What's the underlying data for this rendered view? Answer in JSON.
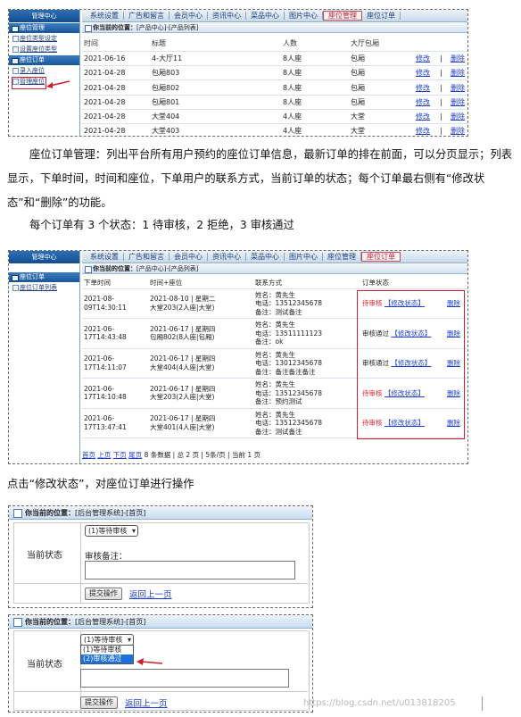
{
  "shot1": {
    "sidebar": {
      "header": "管理中心",
      "group1": "座位管理",
      "items1": [
        "座位类型设定",
        "设置座位类型"
      ],
      "group2": "座位订单",
      "items2": [
        "录入座位",
        "管理座位"
      ]
    },
    "nav": [
      "系统设置",
      "广告和留言",
      "会员中心",
      "资讯中心",
      "菜品中心",
      "图片中心",
      "座位管理",
      "座位订单"
    ],
    "crumb_label": "你当前的位置：",
    "crumb_path": "[产品中心]-[产品列表]",
    "columns": [
      "时间",
      "标题",
      "人数",
      "大厅包厢"
    ],
    "rows": [
      {
        "date": "2021-06-16",
        "title": "4-大厅11",
        "people": "8人座",
        "type": "包厢"
      },
      {
        "date": "2021-04-28",
        "title": "包厢803",
        "people": "8人座",
        "type": "包厢"
      },
      {
        "date": "2021-04-28",
        "title": "包厢802",
        "people": "8人座",
        "type": "包厢"
      },
      {
        "date": "2021-04-28",
        "title": "包厢801",
        "people": "8人座",
        "type": "包厢"
      },
      {
        "date": "2021-04-28",
        "title": "大堂404",
        "people": "4人座",
        "type": "大堂"
      },
      {
        "date": "2021-04-28",
        "title": "大堂403",
        "people": "4人座",
        "type": "大堂"
      }
    ],
    "edit": "修改",
    "del": "删除",
    "sep": "|"
  },
  "para1": "座位订单管理：列出平台所有用户预约的座位订单信息，最新订单的排在前面，可以分页显示；列表显示，下单时间，时间和座位，下单用户的联系方式，当前订单的状态；每个订单最右侧有“修改状态”和“删除”的功能。",
  "para2": "每个订单有 3 个状态：1 待审核，2 拒绝，3 审核通过",
  "shot2": {
    "sidebar": {
      "header": "管理中心",
      "group": "座位订单",
      "item": "座位订单列表"
    },
    "nav": [
      "系统设置",
      "广告和留言",
      "会员中心",
      "资讯中心",
      "菜品中心",
      "图片中心",
      "座位管理",
      "座位订单"
    ],
    "crumb_label": "你当前的位置：",
    "crumb_path": "[产品中心]-[产品列表]",
    "columns": [
      "下单时间",
      "时间+座位",
      "联系方式",
      "订单状态"
    ],
    "rows": [
      {
        "t1": "2021-08-",
        "t2": "09T14:30:11",
        "s1": "2021-08-10 | 星期二",
        "s2": "大堂203(2人座|大堂)",
        "c1": "姓名：黄先生",
        "c2": "电话：13512345678",
        "c3": "备注：测试备注",
        "status": "待审核",
        "red": true
      },
      {
        "t1": "2021-06-",
        "t2": "17T14:43:48",
        "s1": "2021-06-17 | 星期四",
        "s2": "包厢802(8人座|包厢)",
        "c1": "姓名：黄先生",
        "c2": "电话：13511111123",
        "c3": "备注：ok",
        "status": "审核通过",
        "red": false
      },
      {
        "t1": "2021-06-",
        "t2": "17T14:11:07",
        "s1": "2021-06-17 | 星期四",
        "s2": "大堂404(4人座|大堂)",
        "c1": "姓名：黄先生",
        "c2": "电话：13012345678",
        "c3": "备注：备注备注备注",
        "status": "审核通过",
        "red": false
      },
      {
        "t1": "2021-06-",
        "t2": "17T14:10:48",
        "s1": "2021-06-17 | 星期四",
        "s2": "大堂203(2人座|大堂)",
        "c1": "姓名：黄先生",
        "c2": "电话：13512345678",
        "c3": "备注：预约测试",
        "status": "待审核",
        "red": true
      },
      {
        "t1": "2021-06-",
        "t2": "17T13:47:41",
        "s1": "2021-06-17 | 星期四",
        "s2": "大堂401(4人座|大堂)",
        "c1": "姓名：黄先生",
        "c2": "电话：13512345678",
        "c3": "备注：测试备注",
        "status": "待审核",
        "red": true
      }
    ],
    "modify": "【修改状态】",
    "del": "删除",
    "pager": {
      "first": "首页",
      "prev": "上页",
      "next": "下页",
      "last": "尾页",
      "info": "8 条数据 | 总 2 页 | 5条/页 | 当前 1 页"
    }
  },
  "para3": "点击“修改状态”，对座位订单进行操作",
  "form1": {
    "crumb_label": "你当前的位置：",
    "crumb_path": "[后台管理系统]-[首页]",
    "label": "当前状态",
    "select": "(1)等待审核",
    "note": "审核备注：",
    "submit": "提交操作",
    "back": "返回上一页"
  },
  "form2": {
    "crumb_label": "你当前的位置：",
    "crumb_path": "[后台管理系统]-[首页]",
    "label": "当前状态",
    "select": "(1)等待审核",
    "options": [
      "(1)等待审核",
      "(2)审核通过"
    ],
    "submit": "提交操作",
    "back": "返回上一页"
  },
  "watermark": "https://blog.csdn.net/u013818205"
}
